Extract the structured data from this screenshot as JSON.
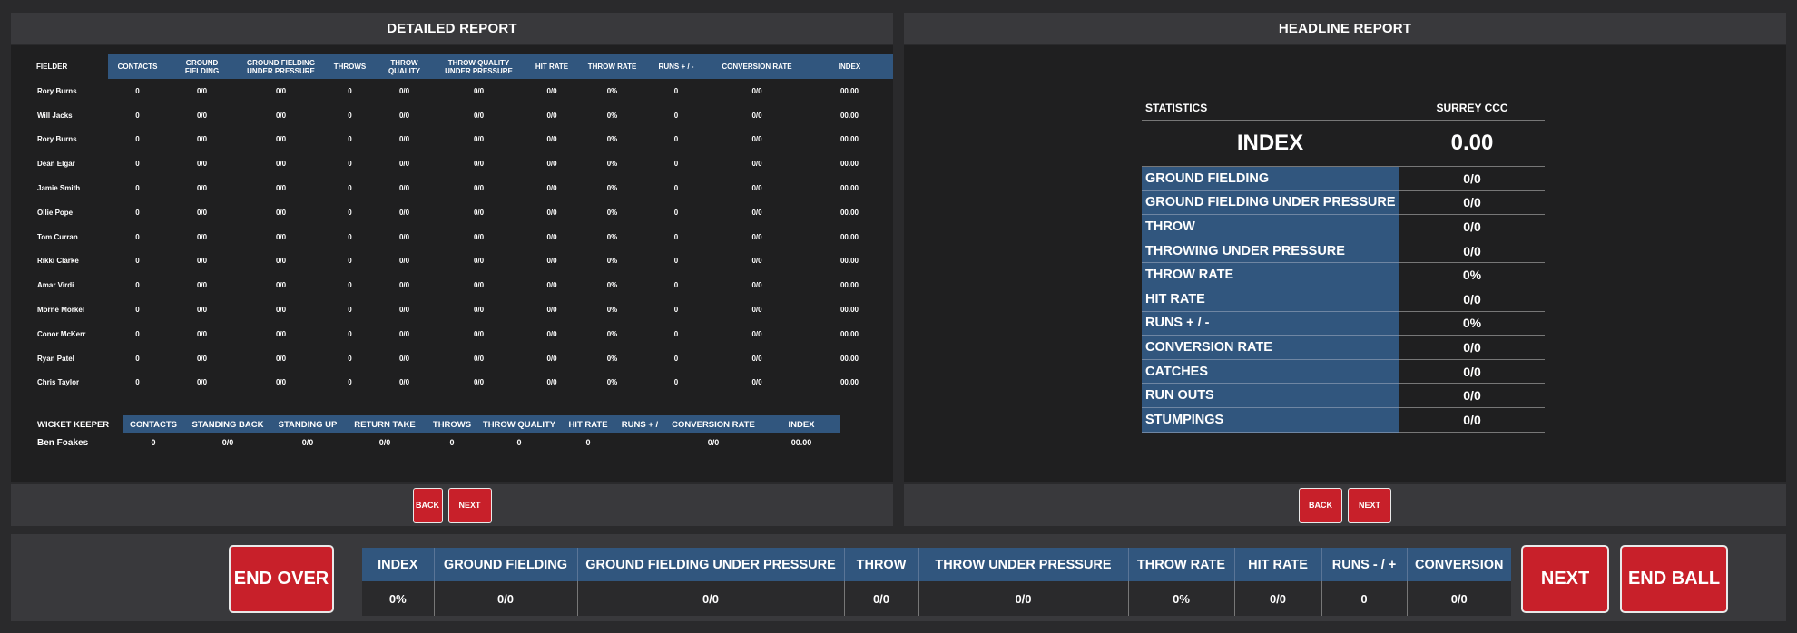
{
  "detailed": {
    "title": "DETAILED REPORT",
    "headers": [
      "FIELDER",
      "CONTACTS",
      "GROUND FIELDING",
      "GROUND FIELDING UNDER PRESSURE",
      "THROWS",
      "THROW QUALITY",
      "THROW QUALITY UNDER PRESSURE",
      "HIT RATE",
      "THROW RATE",
      "RUNS + / -",
      "CONVERSION RATE",
      "INDEX"
    ],
    "rows": [
      [
        "Rory Burns",
        "0",
        "0/0",
        "0/0",
        "0",
        "0/0",
        "0/0",
        "0/0",
        "0%",
        "0",
        "0/0",
        "00.00"
      ],
      [
        "Will Jacks",
        "0",
        "0/0",
        "0/0",
        "0",
        "0/0",
        "0/0",
        "0/0",
        "0%",
        "0",
        "0/0",
        "00.00"
      ],
      [
        "Rory Burns",
        "0",
        "0/0",
        "0/0",
        "0",
        "0/0",
        "0/0",
        "0/0",
        "0%",
        "0",
        "0/0",
        "00.00"
      ],
      [
        "Dean Elgar",
        "0",
        "0/0",
        "0/0",
        "0",
        "0/0",
        "0/0",
        "0/0",
        "0%",
        "0",
        "0/0",
        "00.00"
      ],
      [
        "Jamie Smith",
        "0",
        "0/0",
        "0/0",
        "0",
        "0/0",
        "0/0",
        "0/0",
        "0%",
        "0",
        "0/0",
        "00.00"
      ],
      [
        "Ollie Pope",
        "0",
        "0/0",
        "0/0",
        "0",
        "0/0",
        "0/0",
        "0/0",
        "0%",
        "0",
        "0/0",
        "00.00"
      ],
      [
        "Tom Curran",
        "0",
        "0/0",
        "0/0",
        "0",
        "0/0",
        "0/0",
        "0/0",
        "0%",
        "0",
        "0/0",
        "00.00"
      ],
      [
        "Rikki Clarke",
        "0",
        "0/0",
        "0/0",
        "0",
        "0/0",
        "0/0",
        "0/0",
        "0%",
        "0",
        "0/0",
        "00.00"
      ],
      [
        "Amar Virdi",
        "0",
        "0/0",
        "0/0",
        "0",
        "0/0",
        "0/0",
        "0/0",
        "0%",
        "0",
        "0/0",
        "00.00"
      ],
      [
        "Morne Morkel",
        "0",
        "0/0",
        "0/0",
        "0",
        "0/0",
        "0/0",
        "0/0",
        "0%",
        "0",
        "0/0",
        "00.00"
      ],
      [
        "Conor McKerr",
        "0",
        "0/0",
        "0/0",
        "0",
        "0/0",
        "0/0",
        "0/0",
        "0%",
        "0",
        "0/0",
        "00.00"
      ],
      [
        "Ryan Patel",
        "0",
        "0/0",
        "0/0",
        "0",
        "0/0",
        "0/0",
        "0/0",
        "0%",
        "0",
        "0/0",
        "00.00"
      ],
      [
        "Chris Taylor",
        "0",
        "0/0",
        "0/0",
        "0",
        "0/0",
        "0/0",
        "0/0",
        "0%",
        "0",
        "0/0",
        "00.00"
      ]
    ],
    "keeper_headers": [
      "WICKET KEEPER",
      "CONTACTS",
      "STANDING BACK",
      "STANDING UP",
      "RETURN TAKE",
      "THROWS",
      "THROW QUALITY",
      "HIT RATE",
      "RUNS + /",
      "CONVERSION RATE",
      "INDEX"
    ],
    "keeper_row": [
      "Ben Foakes",
      "0",
      "0/0",
      "0/0",
      "0/0",
      "0",
      "0",
      "0",
      "",
      "0/0",
      "00.00"
    ],
    "back_label": "BACK",
    "next_label": "NEXT"
  },
  "headline": {
    "title": "HEADLINE REPORT",
    "col_stat": "STATISTICS",
    "col_team": "SURREY CCC",
    "index_label": "INDEX",
    "index_value": "0.00",
    "rows": [
      {
        "label": "GROUND FIELDING",
        "value": "0/0"
      },
      {
        "label": "GROUND FIELDING UNDER PRESSURE",
        "value": "0/0"
      },
      {
        "label": "THROW",
        "value": "0/0"
      },
      {
        "label": "THROWING UNDER PRESSURE",
        "value": "0/0"
      },
      {
        "label": "THROW RATE",
        "value": "0%"
      },
      {
        "label": "HIT RATE",
        "value": "0/0"
      },
      {
        "label": "RUNS + / -",
        "value": "0%"
      },
      {
        "label": "CONVERSION RATE",
        "value": "0/0"
      },
      {
        "label": "CATCHES",
        "value": "0/0"
      },
      {
        "label": "RUN OUTS",
        "value": "0/0"
      },
      {
        "label": "STUMPINGS",
        "value": "0/0"
      }
    ],
    "back_label": "BACK",
    "next_label": "NEXT"
  },
  "bottom": {
    "end_over_label": "END OVER",
    "next_label": "NEXT",
    "end_ball_label": "END BALL",
    "headers": [
      "INDEX",
      "GROUND FIELDING",
      "GROUND FIELDING UNDER PRESSURE",
      "THROW",
      "THROW UNDER PRESSURE",
      "THROW RATE",
      "HIT RATE",
      "RUNS - / +",
      "CONVERSION"
    ],
    "values": [
      "0%",
      "0/0",
      "0/0",
      "0/0",
      "0/0",
      "0%",
      "0/0",
      "0",
      "0/0"
    ]
  },
  "colors": {
    "background": "#2a2a2c",
    "panel": "#39393c",
    "panel_body": "#1f1f20",
    "header_blue": "#31567e",
    "button_red": "#c8202a"
  }
}
